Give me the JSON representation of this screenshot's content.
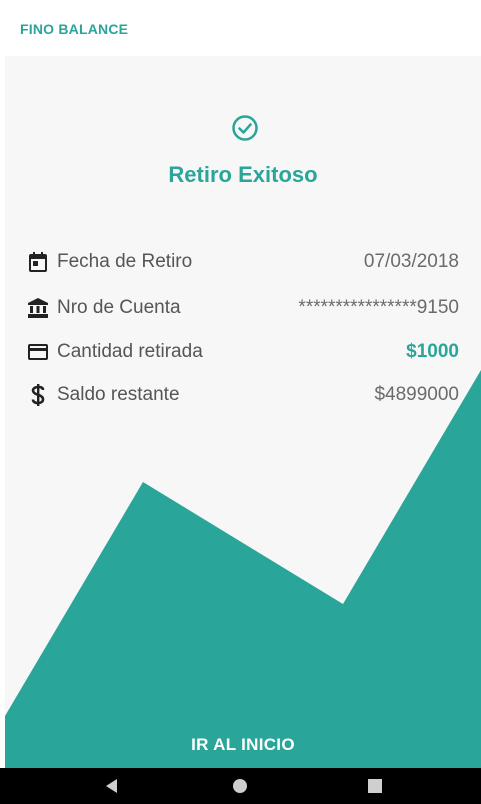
{
  "app": {
    "title": "FINO BALANCE"
  },
  "result": {
    "title": "Retiro Exitoso",
    "status_icon": "check-circle-icon"
  },
  "details": [
    {
      "label": "Fecha de Retiro",
      "value": "07/03/2018",
      "icon": "calendar-icon"
    },
    {
      "label": "Nro de Cuenta",
      "value": "****************9150",
      "icon": "bank-icon"
    },
    {
      "label": "Cantidad retirada",
      "value": "$1000",
      "icon": "credit-card-icon"
    },
    {
      "label": "Saldo restante",
      "value": "$4899000",
      "icon": "dollar-icon"
    }
  ],
  "actions": {
    "home_label": "IR AL INICIO"
  },
  "nav": [
    "back-icon",
    "home-icon",
    "recents-icon"
  ],
  "colors": {
    "accent": "#2aa59a",
    "card_bg": "#f7f7f7",
    "text": "#555555"
  }
}
